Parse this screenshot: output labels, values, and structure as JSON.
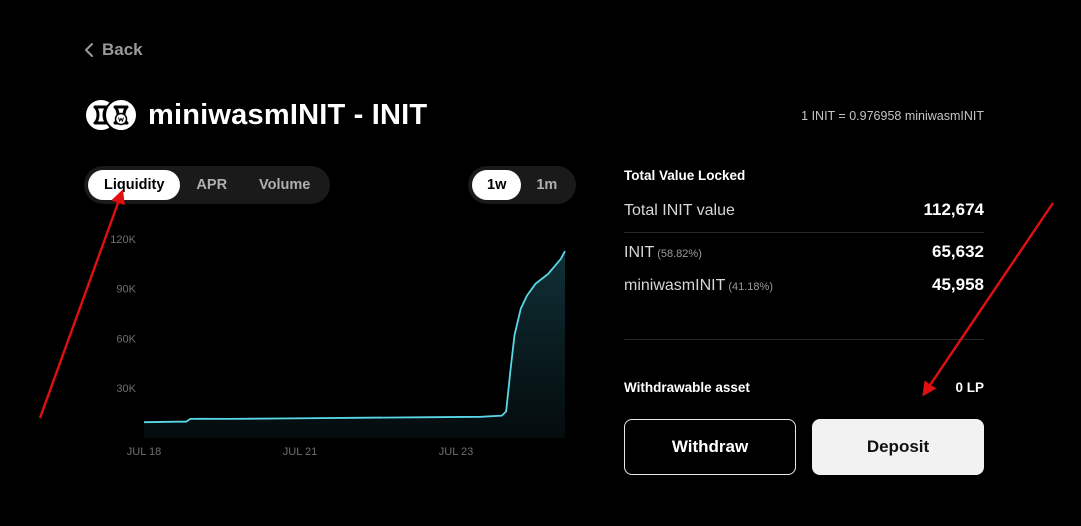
{
  "nav": {
    "back_label": "Back"
  },
  "header": {
    "title": "miniwasmINIT - INIT",
    "exchange_rate": "1 INIT = 0.976958 miniwasmINIT"
  },
  "chart_tabs": [
    {
      "label": "Liquidity",
      "active": true
    },
    {
      "label": "APR",
      "active": false
    },
    {
      "label": "Volume",
      "active": false
    }
  ],
  "range_tabs": [
    {
      "label": "1w",
      "active": true
    },
    {
      "label": "1m",
      "active": false
    }
  ],
  "chart_data": {
    "type": "area",
    "x_tick_labels": [
      "JUL 18",
      "JUL 21",
      "JUL 23"
    ],
    "y_tick_labels": [
      "30K",
      "60K",
      "90K",
      "120K"
    ],
    "y_ticks": [
      30000,
      60000,
      90000,
      120000
    ],
    "ylim": [
      0,
      123000
    ],
    "grid": false,
    "color": "#5ad7e6",
    "x": [
      0,
      0.08,
      0.1,
      0.11,
      0.13,
      0.2,
      0.35,
      0.5,
      0.65,
      0.8,
      0.85,
      0.86,
      0.87,
      0.88,
      0.895,
      0.91,
      0.93,
      0.96,
      0.99,
      1.0
    ],
    "values": [
      9500,
      9800,
      9800,
      11500,
      11600,
      11500,
      11800,
      12200,
      12500,
      12800,
      13500,
      16000,
      40000,
      62000,
      78000,
      86000,
      93000,
      99000,
      108000,
      112674
    ]
  },
  "tvl": {
    "title": "Total Value Locked",
    "total_label": "Total INIT value",
    "total_value": "112,674",
    "init_label": "INIT",
    "init_pct": "(58.82%)",
    "init_value": "65,632",
    "mini_label": "miniwasmINIT",
    "mini_pct": "(41.18%)",
    "mini_value": "45,958"
  },
  "withdrawable": {
    "label": "Withdrawable asset",
    "value": "0 LP"
  },
  "actions": {
    "withdraw_label": "Withdraw",
    "deposit_label": "Deposit"
  },
  "colors": {
    "accent": "#5ad7e6",
    "annotation_arrow": "#e01010"
  }
}
